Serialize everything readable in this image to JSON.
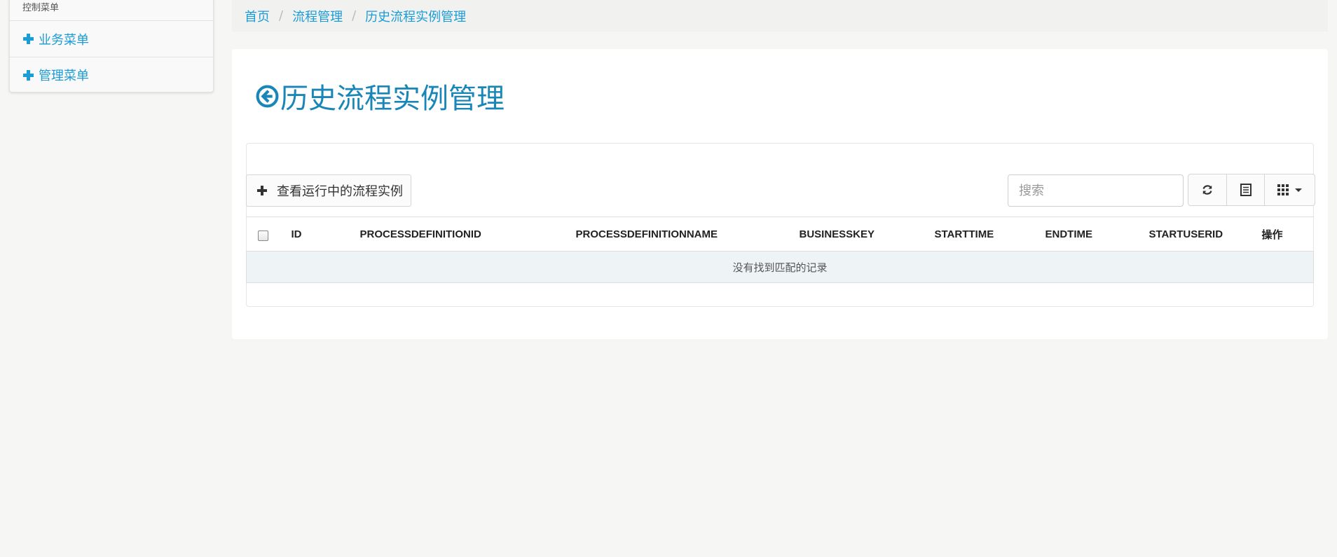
{
  "sidebar": {
    "header": "控制菜单",
    "items": [
      {
        "label": "业务菜单",
        "icon": "plus-icon"
      },
      {
        "label": "管理菜单",
        "icon": "plus-icon"
      }
    ]
  },
  "breadcrumb": {
    "items": [
      "首页",
      "流程管理",
      "历史流程实例管理"
    ],
    "separator": "/"
  },
  "page": {
    "title": "历史流程实例管理",
    "title_icon": "arrow-circle-left-icon"
  },
  "toolbar": {
    "view_running_label": "查看运行中的流程实例",
    "search_placeholder": "搜索",
    "refresh_icon": "refresh-icon",
    "toggle_icon": "list-view-icon",
    "columns_icon": "grid-columns-icon"
  },
  "table": {
    "columns": [
      "ID",
      "PROCESSDEFINITIONID",
      "PROCESSDEFINITIONNAME",
      "BUSINESSKEY",
      "STARTTIME",
      "ENDTIME",
      "STARTUSERID",
      "操作"
    ],
    "empty_message": "没有找到匹配的记录"
  },
  "colors": {
    "accent": "#1a9cd6",
    "title": "#1a86b8",
    "background": "#f6f6f4",
    "empty_row": "#eef3f6"
  }
}
